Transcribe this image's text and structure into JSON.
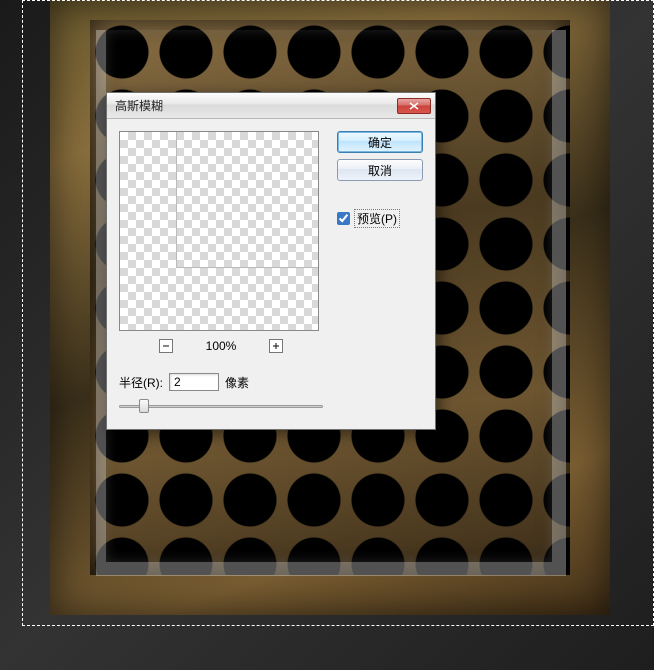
{
  "dialog": {
    "title": "高斯模糊",
    "buttons": {
      "ok": "确定",
      "cancel": "取消"
    },
    "preview": {
      "checked": true,
      "label": "预览(P)"
    },
    "zoom": {
      "minus_icon": "minus-icon",
      "plus_icon": "plus-icon",
      "value": "100%"
    },
    "radius": {
      "label": "半径(R):",
      "value": "2",
      "unit": "像素"
    },
    "close_icon": "close-icon"
  }
}
